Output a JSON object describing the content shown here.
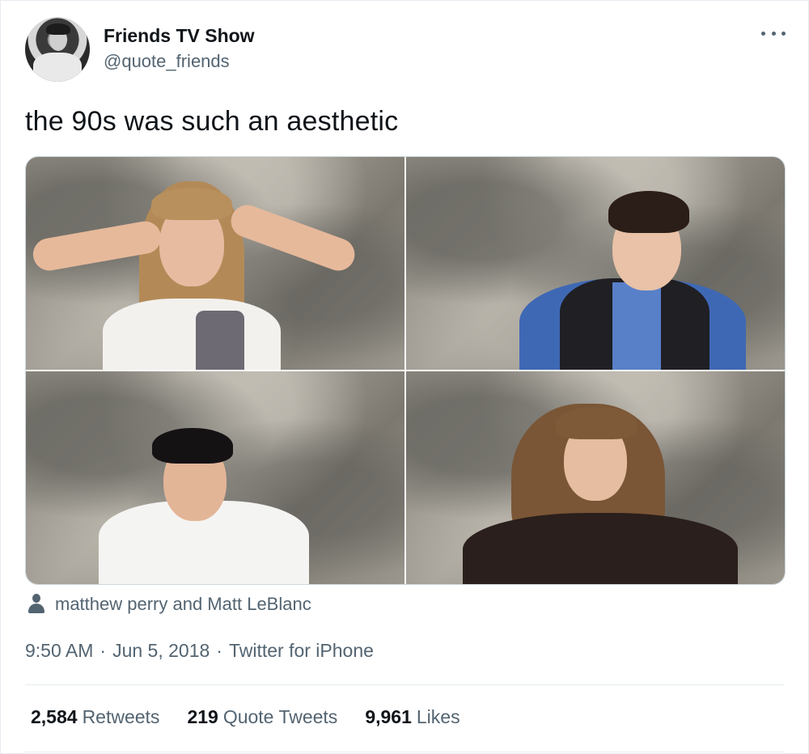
{
  "account": {
    "display_name": "Friends TV Show",
    "handle": "@quote_friends"
  },
  "tweet": {
    "text": "the 90s was such an aesthetic",
    "tagged_people": "matthew perry and Matt LeBlanc",
    "time": "9:50 AM",
    "date": "Jun 5, 2018",
    "source": "Twitter for iPhone",
    "separator": "·"
  },
  "stats": {
    "retweets_count": "2,584",
    "retweets_label": "Retweets",
    "quotes_count": "219",
    "quotes_label": "Quote Tweets",
    "likes_count": "9,961",
    "likes_label": "Likes"
  },
  "icons": {
    "more": "more-options-icon",
    "tag": "person-icon"
  },
  "colors": {
    "text_primary": "#0f1419",
    "text_secondary": "#536471",
    "border": "#e6ecf0"
  }
}
